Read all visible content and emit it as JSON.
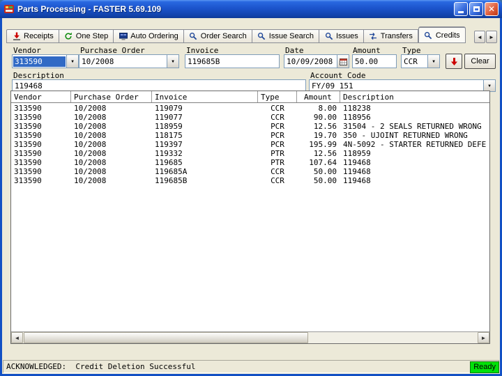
{
  "window": {
    "title": "Parts Processing - FASTER 5.69.109",
    "status_text": "ACKNOWLEDGED:  Credit Deletion Successful",
    "ready_label": "Ready"
  },
  "colors": {
    "titlebar_blue": "#1C54CC",
    "selection_blue": "#316AC5",
    "ready_green": "#00E109",
    "action_arrow_red": "#CC0000"
  },
  "tabs": [
    {
      "label": "Receipts",
      "icon": "receipts-icon",
      "active": false
    },
    {
      "label": "One Step",
      "icon": "one-step-icon",
      "active": false
    },
    {
      "label": "Auto Ordering",
      "icon": "auto-ordering-icon",
      "active": false
    },
    {
      "label": "Order Search",
      "icon": "search-icon",
      "active": false
    },
    {
      "label": "Issue Search",
      "icon": "search-icon",
      "active": false
    },
    {
      "label": "Issues",
      "icon": "search-icon",
      "active": false
    },
    {
      "label": "Transfers",
      "icon": "transfers-icon",
      "active": false
    },
    {
      "label": "Credits",
      "icon": "search-icon",
      "active": true
    }
  ],
  "form": {
    "vendor_label": "Vendor",
    "vendor_value": "313590",
    "purchase_order_label": "Purchase Order",
    "purchase_order_value": "10/2008",
    "invoice_label": "Invoice",
    "invoice_value": "119685B",
    "date_label": "Date",
    "date_value": "10/09/2008",
    "amount_label": "Amount",
    "amount_value": "50.00",
    "type_label": "Type",
    "type_value": "CCR",
    "clear_label": "Clear",
    "description_label": "Description",
    "description_value": "119468",
    "account_code_label": "Account Code",
    "account_code_value": "FY/09 151"
  },
  "table": {
    "columns": [
      "Vendor",
      "Purchase Order",
      "Invoice",
      "Type",
      "Amount",
      "Description"
    ],
    "rows": [
      [
        "313590",
        "10/2008",
        "119079",
        "CCR",
        "8.00",
        "118238"
      ],
      [
        "313590",
        "10/2008",
        "119077",
        "CCR",
        "90.00",
        "118956"
      ],
      [
        "313590",
        "10/2008",
        "118959",
        "PCR",
        "12.56",
        "31504 - 2 SEALS RETURNED WRONG"
      ],
      [
        "313590",
        "10/2008",
        "118175",
        "PCR",
        "19.70",
        "350 - UJOINT RETURNED WRONG"
      ],
      [
        "313590",
        "10/2008",
        "119397",
        "PCR",
        "195.99",
        "4N-5092 - STARTER RETURNED DEFE"
      ],
      [
        "313590",
        "10/2008",
        "119332",
        "PTR",
        "12.56",
        "118959"
      ],
      [
        "313590",
        "10/2008",
        "119685",
        "PTR",
        "107.64",
        "119468"
      ],
      [
        "313590",
        "10/2008",
        "119685A",
        "CCR",
        "50.00",
        "119468"
      ],
      [
        "313590",
        "10/2008",
        "119685B",
        "CCR",
        "50.00",
        "119468"
      ]
    ]
  }
}
